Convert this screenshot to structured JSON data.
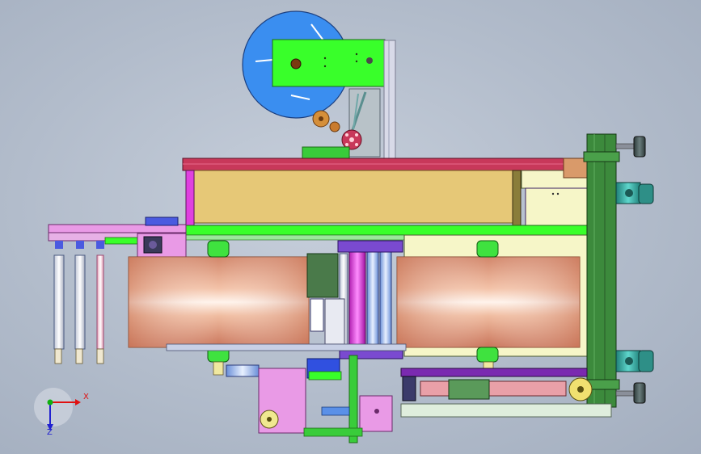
{
  "viewport": {
    "background_top": "#c7cfdb",
    "background_bottom": "#a3aebf"
  },
  "triad": {
    "x_label": "X",
    "z_label": "Z",
    "x_color": "#e01010",
    "y_color": "#10b010",
    "z_color": "#2020d0"
  },
  "colors": {
    "reel_disc": "#3a8ef0",
    "green_plate": "#39ff2a",
    "copper": "#d98b69",
    "yellow_panel": "#e6c877",
    "crimson_rail": "#c8385a",
    "magenta": "#e040e0",
    "dark_green_column": "#3c8a3c",
    "teal_motor": "#2fa8a0",
    "pale_yellow": "#f6f6c8",
    "pink_block": "#e99ae6"
  }
}
